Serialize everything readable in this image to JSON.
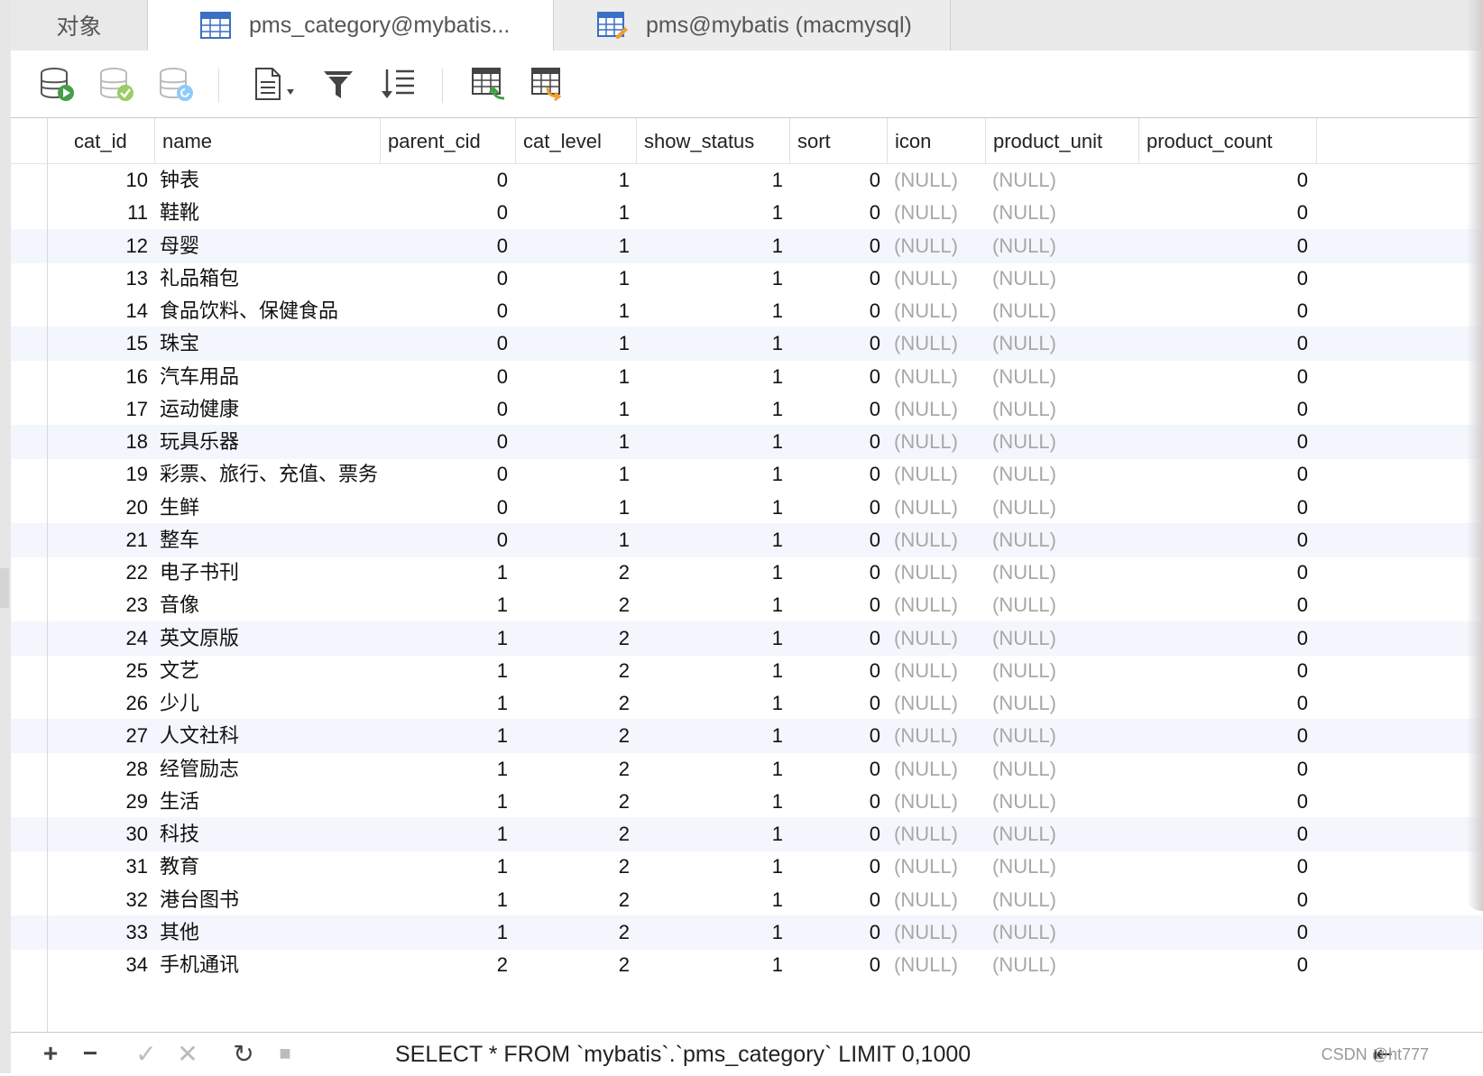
{
  "tabs": [
    {
      "label": "对象"
    },
    {
      "label": "pms_category@mybatis..."
    },
    {
      "label": "pms@mybatis (macmysql)"
    }
  ],
  "columns": [
    "cat_id",
    "name",
    "parent_cid",
    "cat_level",
    "show_status",
    "sort",
    "icon",
    "product_unit",
    "product_count"
  ],
  "rows": [
    {
      "cat_id": "10",
      "name": "钟表",
      "parent_cid": "0",
      "cat_level": "1",
      "show_status": "1",
      "sort": "0",
      "icon": "(NULL)",
      "product_unit": "(NULL)",
      "product_count": "0"
    },
    {
      "cat_id": "11",
      "name": "鞋靴",
      "parent_cid": "0",
      "cat_level": "1",
      "show_status": "1",
      "sort": "0",
      "icon": "(NULL)",
      "product_unit": "(NULL)",
      "product_count": "0"
    },
    {
      "cat_id": "12",
      "name": "母婴",
      "parent_cid": "0",
      "cat_level": "1",
      "show_status": "1",
      "sort": "0",
      "icon": "(NULL)",
      "product_unit": "(NULL)",
      "product_count": "0"
    },
    {
      "cat_id": "13",
      "name": "礼品箱包",
      "parent_cid": "0",
      "cat_level": "1",
      "show_status": "1",
      "sort": "0",
      "icon": "(NULL)",
      "product_unit": "(NULL)",
      "product_count": "0"
    },
    {
      "cat_id": "14",
      "name": "食品饮料、保健食品",
      "parent_cid": "0",
      "cat_level": "1",
      "show_status": "1",
      "sort": "0",
      "icon": "(NULL)",
      "product_unit": "(NULL)",
      "product_count": "0"
    },
    {
      "cat_id": "15",
      "name": "珠宝",
      "parent_cid": "0",
      "cat_level": "1",
      "show_status": "1",
      "sort": "0",
      "icon": "(NULL)",
      "product_unit": "(NULL)",
      "product_count": "0"
    },
    {
      "cat_id": "16",
      "name": "汽车用品",
      "parent_cid": "0",
      "cat_level": "1",
      "show_status": "1",
      "sort": "0",
      "icon": "(NULL)",
      "product_unit": "(NULL)",
      "product_count": "0"
    },
    {
      "cat_id": "17",
      "name": "运动健康",
      "parent_cid": "0",
      "cat_level": "1",
      "show_status": "1",
      "sort": "0",
      "icon": "(NULL)",
      "product_unit": "(NULL)",
      "product_count": "0"
    },
    {
      "cat_id": "18",
      "name": "玩具乐器",
      "parent_cid": "0",
      "cat_level": "1",
      "show_status": "1",
      "sort": "0",
      "icon": "(NULL)",
      "product_unit": "(NULL)",
      "product_count": "0"
    },
    {
      "cat_id": "19",
      "name": "彩票、旅行、充值、票务",
      "parent_cid": "0",
      "cat_level": "1",
      "show_status": "1",
      "sort": "0",
      "icon": "(NULL)",
      "product_unit": "(NULL)",
      "product_count": "0"
    },
    {
      "cat_id": "20",
      "name": "生鲜",
      "parent_cid": "0",
      "cat_level": "1",
      "show_status": "1",
      "sort": "0",
      "icon": "(NULL)",
      "product_unit": "(NULL)",
      "product_count": "0"
    },
    {
      "cat_id": "21",
      "name": "整车",
      "parent_cid": "0",
      "cat_level": "1",
      "show_status": "1",
      "sort": "0",
      "icon": "(NULL)",
      "product_unit": "(NULL)",
      "product_count": "0"
    },
    {
      "cat_id": "22",
      "name": "电子书刊",
      "parent_cid": "1",
      "cat_level": "2",
      "show_status": "1",
      "sort": "0",
      "icon": "(NULL)",
      "product_unit": "(NULL)",
      "product_count": "0"
    },
    {
      "cat_id": "23",
      "name": "音像",
      "parent_cid": "1",
      "cat_level": "2",
      "show_status": "1",
      "sort": "0",
      "icon": "(NULL)",
      "product_unit": "(NULL)",
      "product_count": "0"
    },
    {
      "cat_id": "24",
      "name": "英文原版",
      "parent_cid": "1",
      "cat_level": "2",
      "show_status": "1",
      "sort": "0",
      "icon": "(NULL)",
      "product_unit": "(NULL)",
      "product_count": "0"
    },
    {
      "cat_id": "25",
      "name": "文艺",
      "parent_cid": "1",
      "cat_level": "2",
      "show_status": "1",
      "sort": "0",
      "icon": "(NULL)",
      "product_unit": "(NULL)",
      "product_count": "0"
    },
    {
      "cat_id": "26",
      "name": "少儿",
      "parent_cid": "1",
      "cat_level": "2",
      "show_status": "1",
      "sort": "0",
      "icon": "(NULL)",
      "product_unit": "(NULL)",
      "product_count": "0"
    },
    {
      "cat_id": "27",
      "name": "人文社科",
      "parent_cid": "1",
      "cat_level": "2",
      "show_status": "1",
      "sort": "0",
      "icon": "(NULL)",
      "product_unit": "(NULL)",
      "product_count": "0"
    },
    {
      "cat_id": "28",
      "name": "经管励志",
      "parent_cid": "1",
      "cat_level": "2",
      "show_status": "1",
      "sort": "0",
      "icon": "(NULL)",
      "product_unit": "(NULL)",
      "product_count": "0"
    },
    {
      "cat_id": "29",
      "name": "生活",
      "parent_cid": "1",
      "cat_level": "2",
      "show_status": "1",
      "sort": "0",
      "icon": "(NULL)",
      "product_unit": "(NULL)",
      "product_count": "0"
    },
    {
      "cat_id": "30",
      "name": "科技",
      "parent_cid": "1",
      "cat_level": "2",
      "show_status": "1",
      "sort": "0",
      "icon": "(NULL)",
      "product_unit": "(NULL)",
      "product_count": "0"
    },
    {
      "cat_id": "31",
      "name": "教育",
      "parent_cid": "1",
      "cat_level": "2",
      "show_status": "1",
      "sort": "0",
      "icon": "(NULL)",
      "product_unit": "(NULL)",
      "product_count": "0"
    },
    {
      "cat_id": "32",
      "name": "港台图书",
      "parent_cid": "1",
      "cat_level": "2",
      "show_status": "1",
      "sort": "0",
      "icon": "(NULL)",
      "product_unit": "(NULL)",
      "product_count": "0"
    },
    {
      "cat_id": "33",
      "name": "其他",
      "parent_cid": "1",
      "cat_level": "2",
      "show_status": "1",
      "sort": "0",
      "icon": "(NULL)",
      "product_unit": "(NULL)",
      "product_count": "0"
    },
    {
      "cat_id": "34",
      "name": "手机通讯",
      "parent_cid": "2",
      "cat_level": "2",
      "show_status": "1",
      "sort": "0",
      "icon": "(NULL)",
      "product_unit": "(NULL)",
      "product_count": "0"
    }
  ],
  "statusbar": {
    "add": "+",
    "remove": "−",
    "apply": "✓",
    "discard": "✕",
    "refresh": "↻",
    "stop": "■",
    "sql": "SELECT * FROM `mybatis`.`pms_category` LIMIT 0,1000",
    "first_page": "⇤",
    "watermark": "CSDN @ht777"
  },
  "colors": {
    "accent_blue": "#3a7bd5",
    "green": "#4caf50",
    "orange": "#f0a030",
    "null_text": "#a8a8a8"
  }
}
